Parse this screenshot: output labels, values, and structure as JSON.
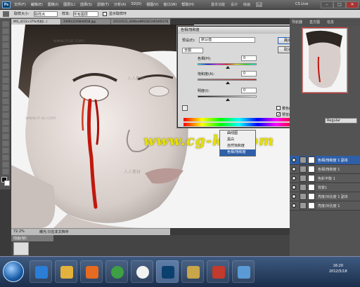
{
  "menubar": {
    "app_logo": "Ps",
    "menus": [
      "文件(F)",
      "编辑(E)",
      "图像(I)",
      "图层(L)",
      "选择(S)",
      "滤镜(T)",
      "分析(A)",
      "3D(D)",
      "视图(V)",
      "窗口(W)",
      "帮助(H)"
    ],
    "workspaces": [
      "基本功能",
      "设计",
      "绘画"
    ],
    "active_workspace": "»",
    "cs_live": "CS Live"
  },
  "optbar": {
    "sample_label": "取样大小:",
    "sample_value": "取样点",
    "sample_all_label": "样本:",
    "sample_all_value": "所有图层",
    "show_ring": "显示取样环"
  },
  "tabs": [
    {
      "label": "IMG_4212×37%(色相/...)",
      "active": true
    },
    {
      "label": "20061222084465B.jpg",
      "active": false
    },
    {
      "label": "20110531_4406ee8903021465465276",
      "active": false
    }
  ],
  "status": {
    "zoom": "72.2%",
    "info": "曝光:只在本文档中"
  },
  "filmstrip": {
    "header": "动画(帧)"
  },
  "dialog": {
    "title": "色相/饱和度",
    "preset_label": "预设(E):",
    "preset_value": "默认值",
    "channel_value": "全图",
    "hue_label": "色相(H):",
    "hue_value": "0",
    "sat_label": "饱和度(A):",
    "sat_value": "0",
    "light_label": "明度(I):",
    "light_value": "0",
    "ok": "确定",
    "cancel": "取消",
    "colorize": "着色(O)",
    "preview": "预览(P)"
  },
  "navigator": {
    "tabs": [
      "导航器",
      "直方图",
      "信息"
    ]
  },
  "context_menu": {
    "items": [
      "曲线图",
      "黑白",
      "自然饱和度",
      "色相/饱和度"
    ],
    "selected": 3
  },
  "layers": {
    "mode": "Regular",
    "rows": [
      {
        "name": "色相/饱和度 1 副本",
        "selected": true
      },
      {
        "name": "色相/饱和度 1",
        "selected": false
      },
      {
        "name": "色彩平衡 1",
        "selected": false
      },
      {
        "name": "背景1",
        "selected": false
      },
      {
        "name": "亮度/对比度 1 副本",
        "selected": false
      },
      {
        "name": "亮度/对比度 1",
        "selected": false
      }
    ]
  },
  "watermarks": {
    "main": "www.cg-ku.com",
    "site": "www.rr-sc.com",
    "cn": "人人素材"
  },
  "taskbar": {
    "time": "16:20",
    "date": "2012/5/18"
  },
  "colors": {
    "accent": "#2f5fa8",
    "blood": "#c0180e",
    "watermark": "#e5e000"
  }
}
